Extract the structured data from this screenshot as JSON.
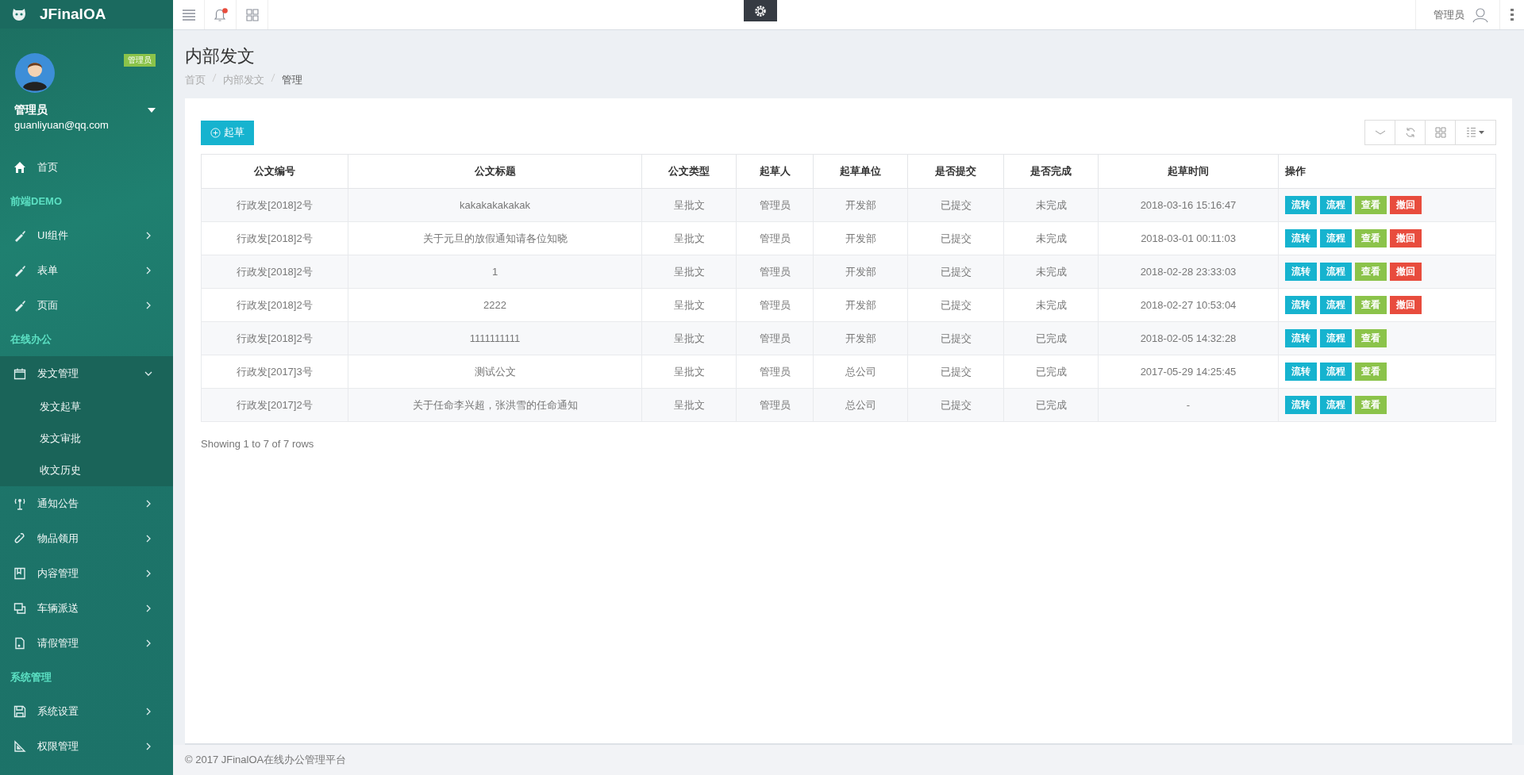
{
  "brand": {
    "name": "JFinalOA"
  },
  "user": {
    "badge": "管理员",
    "name": "管理员",
    "email": "guanliyuan@qq.com"
  },
  "nav": [
    {
      "kind": "link",
      "label": "首页"
    },
    {
      "kind": "section",
      "label": "前端DEMO"
    },
    {
      "kind": "menu",
      "label": "UI组件",
      "expanded": false
    },
    {
      "kind": "menu",
      "label": "表单",
      "expanded": false
    },
    {
      "kind": "menu",
      "label": "页面",
      "expanded": false
    },
    {
      "kind": "section",
      "label": "在线办公"
    },
    {
      "kind": "menu",
      "label": "发文管理",
      "expanded": true,
      "children": [
        {
          "label": "发文起草"
        },
        {
          "label": "发文审批"
        },
        {
          "label": "收文历史"
        }
      ]
    },
    {
      "kind": "menu",
      "label": "通知公告",
      "expanded": false
    },
    {
      "kind": "menu",
      "label": "物品领用",
      "expanded": false
    },
    {
      "kind": "menu",
      "label": "内容管理",
      "expanded": false
    },
    {
      "kind": "menu",
      "label": "车辆派送",
      "expanded": false
    },
    {
      "kind": "menu",
      "label": "请假管理",
      "expanded": false
    },
    {
      "kind": "section",
      "label": "系统管理"
    },
    {
      "kind": "menu",
      "label": "系统设置",
      "expanded": false
    },
    {
      "kind": "menu",
      "label": "权限管理",
      "expanded": false
    }
  ],
  "topbar": {
    "notification": true,
    "user": "管理员"
  },
  "page": {
    "title": "内部发文",
    "breadcrumb": [
      "首页",
      "内部发文",
      "管理"
    ]
  },
  "toolbar": {
    "create_button": "起草"
  },
  "table": {
    "columns": [
      "公文编号",
      "公文标题",
      "公文类型",
      "起草人",
      "起草单位",
      "是否提交",
      "是否完成",
      "起草时间",
      "操作"
    ],
    "rows": [
      {
        "cells": [
          "行政发[2018]2号",
          "kakakakakakak",
          "呈批文",
          "管理员",
          "开发部",
          "已提交",
          "未完成",
          "2018-03-16 15:16:47"
        ],
        "actions": [
          {
            "label": "流转",
            "kind": "info"
          },
          {
            "label": "流程",
            "kind": "info"
          },
          {
            "label": "查看",
            "kind": "success"
          },
          {
            "label": "撤回",
            "kind": "danger"
          }
        ]
      },
      {
        "cells": [
          "行政发[2018]2号",
          "关于元旦的放假通知请各位知晓",
          "呈批文",
          "管理员",
          "开发部",
          "已提交",
          "未完成",
          "2018-03-01 00:11:03"
        ],
        "actions": [
          {
            "label": "流转",
            "kind": "info"
          },
          {
            "label": "流程",
            "kind": "info"
          },
          {
            "label": "查看",
            "kind": "success"
          },
          {
            "label": "撤回",
            "kind": "danger"
          }
        ]
      },
      {
        "cells": [
          "行政发[2018]2号",
          "1",
          "呈批文",
          "管理员",
          "开发部",
          "已提交",
          "未完成",
          "2018-02-28 23:33:03"
        ],
        "actions": [
          {
            "label": "流转",
            "kind": "info"
          },
          {
            "label": "流程",
            "kind": "info"
          },
          {
            "label": "查看",
            "kind": "success"
          },
          {
            "label": "撤回",
            "kind": "danger"
          }
        ]
      },
      {
        "cells": [
          "行政发[2018]2号",
          "2222",
          "呈批文",
          "管理员",
          "开发部",
          "已提交",
          "未完成",
          "2018-02-27 10:53:04"
        ],
        "actions": [
          {
            "label": "流转",
            "kind": "info"
          },
          {
            "label": "流程",
            "kind": "info"
          },
          {
            "label": "查看",
            "kind": "success"
          },
          {
            "label": "撤回",
            "kind": "danger"
          }
        ]
      },
      {
        "cells": [
          "行政发[2018]2号",
          "1111111111",
          "呈批文",
          "管理员",
          "开发部",
          "已提交",
          "已完成",
          "2018-02-05 14:32:28"
        ],
        "actions": [
          {
            "label": "流转",
            "kind": "info"
          },
          {
            "label": "流程",
            "kind": "info"
          },
          {
            "label": "查看",
            "kind": "success"
          }
        ]
      },
      {
        "cells": [
          "行政发[2017]3号",
          "测试公文",
          "呈批文",
          "管理员",
          "总公司",
          "已提交",
          "已完成",
          "2017-05-29 14:25:45"
        ],
        "actions": [
          {
            "label": "流转",
            "kind": "info"
          },
          {
            "label": "流程",
            "kind": "info"
          },
          {
            "label": "查看",
            "kind": "success"
          }
        ]
      },
      {
        "cells": [
          "行政发[2017]2号",
          "关于任命李兴超，张洪雪的任命通知",
          "呈批文",
          "管理员",
          "总公司",
          "已提交",
          "已完成",
          "-"
        ],
        "actions": [
          {
            "label": "流转",
            "kind": "info"
          },
          {
            "label": "流程",
            "kind": "info"
          },
          {
            "label": "查看",
            "kind": "success"
          }
        ]
      }
    ],
    "summary": "Showing 1 to 7 of 7 rows"
  },
  "footer": "© 2017 JFinalOA在线办公管理平台"
}
